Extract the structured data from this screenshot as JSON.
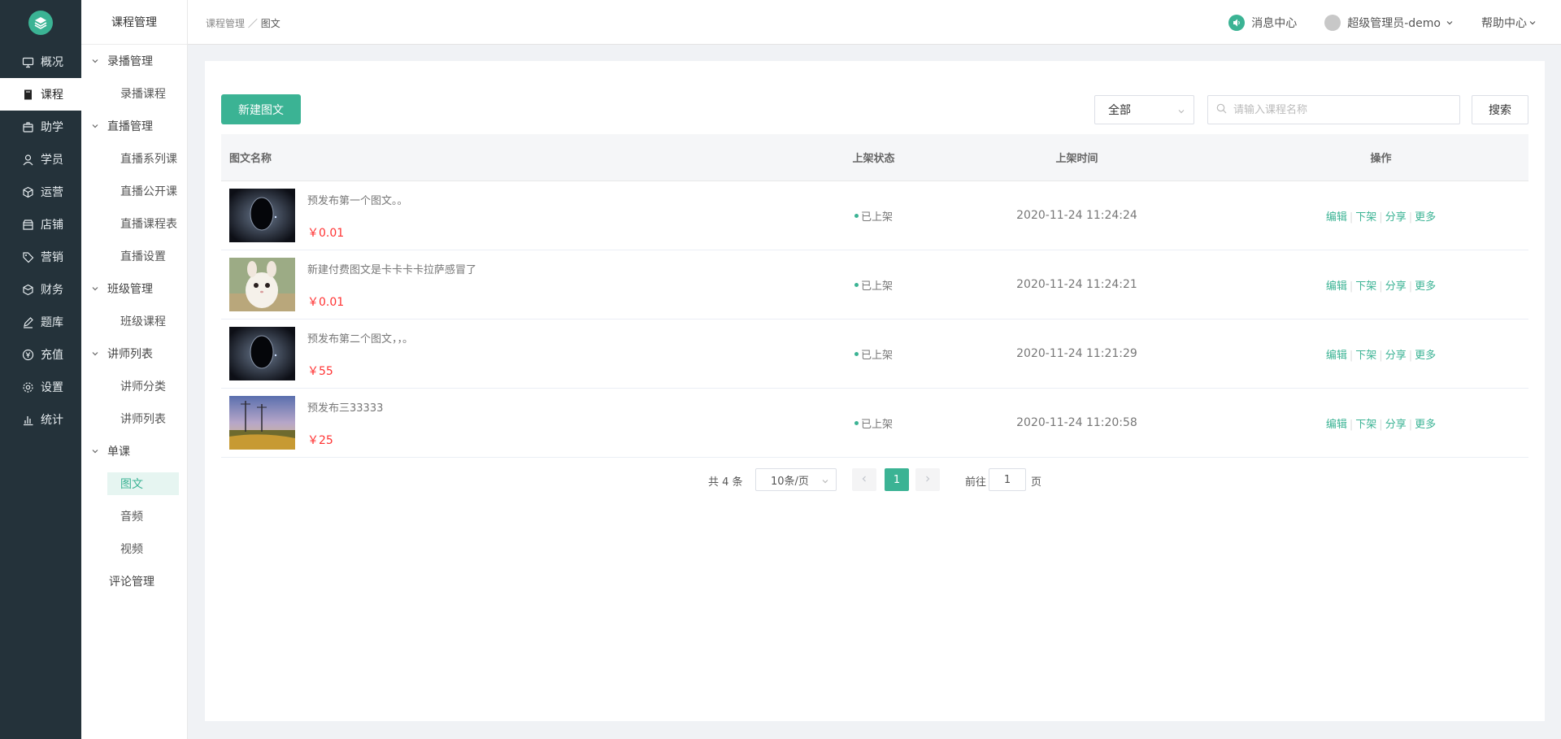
{
  "nav": {
    "items": [
      {
        "label": "概况",
        "icon": "monitor-icon"
      },
      {
        "label": "课程",
        "icon": "book-icon",
        "active": true
      },
      {
        "label": "助学",
        "icon": "box-icon"
      },
      {
        "label": "学员",
        "icon": "user-icon"
      },
      {
        "label": "运营",
        "icon": "cube-icon"
      },
      {
        "label": "店铺",
        "icon": "store-icon"
      },
      {
        "label": "营销",
        "icon": "tag-icon"
      },
      {
        "label": "财务",
        "icon": "wallet-icon"
      },
      {
        "label": "题库",
        "icon": "pen-icon"
      },
      {
        "label": "充值",
        "icon": "yen-icon"
      },
      {
        "label": "设置",
        "icon": "gear-icon"
      },
      {
        "label": "统计",
        "icon": "bar-chart-icon"
      }
    ]
  },
  "subnav": {
    "title": "课程管理",
    "groups": [
      {
        "label": "录播管理",
        "items": [
          "录播课程"
        ]
      },
      {
        "label": "直播管理",
        "items": [
          "直播系列课",
          "直播公开课",
          "直播课程表",
          "直播设置"
        ]
      },
      {
        "label": "班级管理",
        "items": [
          "班级课程"
        ]
      },
      {
        "label": "讲师列表",
        "items": [
          "讲师分类",
          "讲师列表"
        ]
      },
      {
        "label": "单课",
        "items": [
          "图文",
          "音频",
          "视频"
        ]
      }
    ],
    "extra": "评论管理"
  },
  "header": {
    "breadcrumb_parent": "课程管理",
    "breadcrumb_sep": "／",
    "breadcrumb_current": "图文",
    "messages": "消息中心",
    "user": "超级管理员-demo",
    "help": "帮助中心"
  },
  "toolbar": {
    "create_label": "新建图文",
    "filter_value": "全部",
    "search_placeholder": "请输入课程名称",
    "search_label": "搜索"
  },
  "table": {
    "headers": {
      "name": "图文名称",
      "status": "上架状态",
      "time": "上架时间",
      "ops": "操作"
    },
    "rows": [
      {
        "title": "预发布第一个图文。。",
        "price": "￥0.01",
        "status": "已上架",
        "time": "2020-11-24 11:24:24",
        "thumb": "space"
      },
      {
        "title": "新建付费图文是卡卡卡卡拉萨感冒了",
        "price": "￥0.01",
        "status": "已上架",
        "time": "2020-11-24 11:24:21",
        "thumb": "cat"
      },
      {
        "title": "预发布第二个图文，，。",
        "price": "￥55",
        "status": "已上架",
        "time": "2020-11-24 11:21:29",
        "thumb": "space"
      },
      {
        "title": "预发布三33333",
        "price": "￥25",
        "status": "已上架",
        "time": "2020-11-24 11:20:58",
        "thumb": "landscape"
      }
    ],
    "actions": [
      "编辑",
      "下架",
      "分享",
      "更多"
    ]
  },
  "pagination": {
    "total": "共 4 条",
    "page_size": "10条/页",
    "current_page": "1",
    "goto_label": "前往",
    "goto_value": "1",
    "page_unit": "页"
  },
  "colors": {
    "accent": "#3bb394",
    "sidebar": "#24323a",
    "price": "#ff3333"
  }
}
